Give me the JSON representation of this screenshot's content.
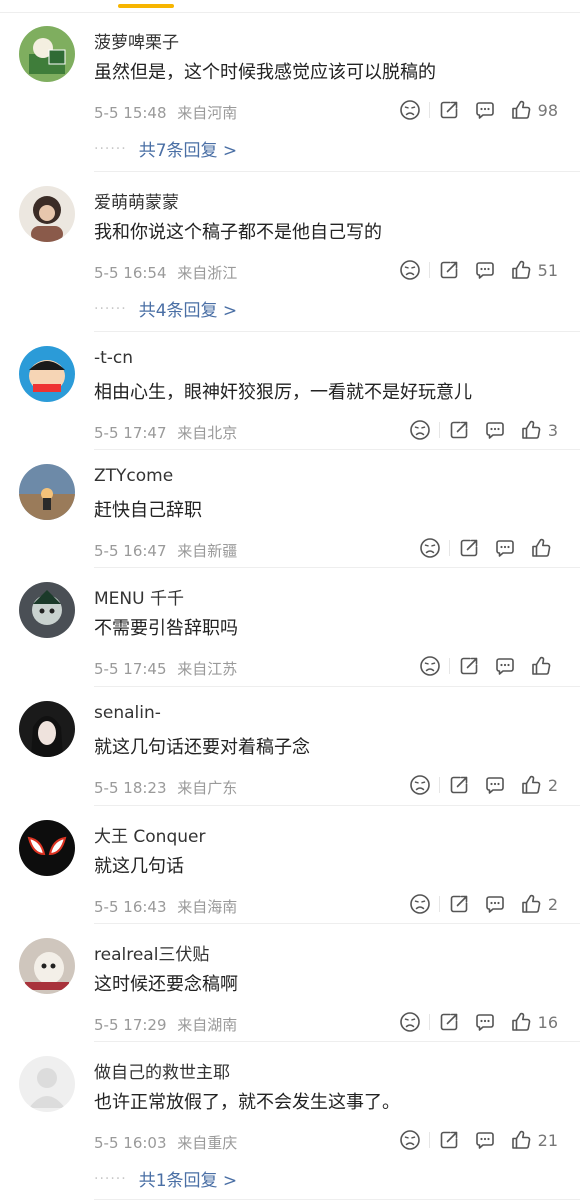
{
  "comments": [
    {
      "username": "菠萝啤栗子",
      "text": "虽然但是，这个时候我感觉应该可以脱稿的",
      "date": "5-5",
      "time": "15:48",
      "location": "来自河南",
      "likes": "98",
      "replies": "共7条回复 >"
    },
    {
      "username": "爱萌萌蒙蒙",
      "text": "我和你说这个稿子都不是他自己写的",
      "date": "5-5",
      "time": "16:54",
      "location": "来自浙江",
      "likes": "51",
      "replies": "共4条回复 >"
    },
    {
      "username": "-t-cn",
      "text": "相由心生，眼神奸狡狠厉，一看就不是好玩意儿",
      "date": "5-5",
      "time": "17:47",
      "location": "来自北京",
      "likes": "3"
    },
    {
      "username": "ZTYcome",
      "text": "赶快自己辞职",
      "date": "5-5",
      "time": "16:47",
      "location": "来自新疆",
      "likes": ""
    },
    {
      "username": "MENU 千千",
      "text": "不需要引咎辞职吗",
      "date": "5-5",
      "time": "17:45",
      "location": "来自江苏",
      "likes": ""
    },
    {
      "username": "senalin-",
      "text": "就这几句话还要对着稿子念",
      "date": "5-5",
      "time": "18:23",
      "location": "来自广东",
      "likes": "2"
    },
    {
      "username": "大王 Conquer",
      "text": "就这几句话",
      "date": "5-5",
      "time": "16:43",
      "location": "来自海南",
      "likes": "2"
    },
    {
      "username": "realreal三伏贴",
      "text": "这时候还要念稿啊",
      "date": "5-5",
      "time": "17:29",
      "location": "来自湖南",
      "likes": "16"
    },
    {
      "username": "做自己的救世主耶",
      "text": "也许正常放假了，就不会发生这事了。",
      "date": "5-5",
      "time": "16:03",
      "location": "来自重庆",
      "likes": "21",
      "replies": "共1条回复 >"
    }
  ],
  "colors": {
    "accent": "#f7b500",
    "reply_link": "#4a6fa5",
    "meta": "#9a9a9a"
  },
  "icons": [
    "dislike-face-icon",
    "share-icon",
    "comment-icon",
    "thumbs-up-icon"
  ]
}
